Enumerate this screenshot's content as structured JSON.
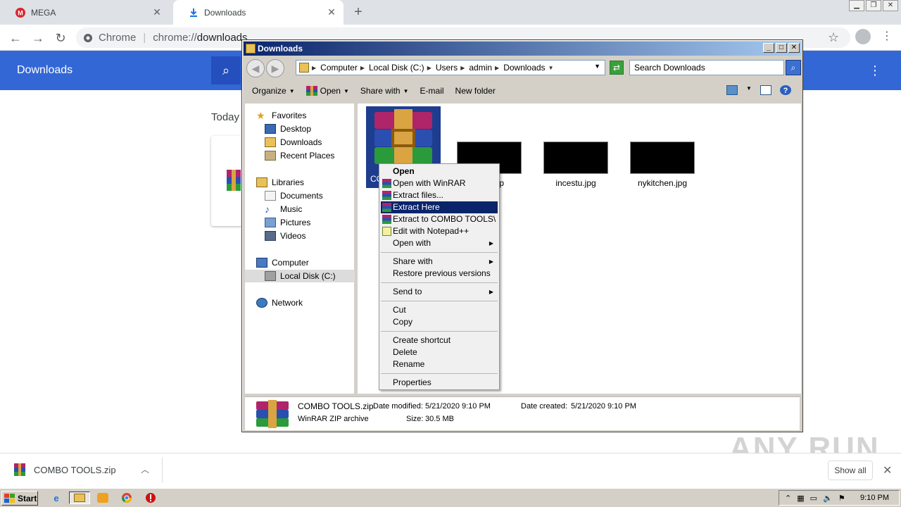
{
  "browser": {
    "tabs": [
      {
        "label": "MEGA",
        "favicon": "mega-icon"
      },
      {
        "label": "Downloads",
        "favicon": "download-icon"
      }
    ],
    "omnibox": {
      "site": "Chrome",
      "url_prefix": "chrome://",
      "url_path": "downloads"
    }
  },
  "downloads_page": {
    "title": "Downloads",
    "section": "Today"
  },
  "explorer": {
    "title": "Downloads",
    "breadcrumb": [
      "Computer",
      "Local Disk (C:)",
      "Users",
      "admin",
      "Downloads"
    ],
    "search_placeholder": "Search Downloads",
    "commands": {
      "organize": "Organize",
      "open": "Open",
      "share": "Share with",
      "email": "E-mail",
      "new_folder": "New folder"
    },
    "nav": {
      "favorites": "Favorites",
      "desktop": "Desktop",
      "downloads": "Downloads",
      "recent": "Recent Places",
      "libraries": "Libraries",
      "documents": "Documents",
      "music": "Music",
      "pictures": "Pictures",
      "videos": "Videos",
      "computer": "Computer",
      "local_disk": "Local Disk (C:)",
      "network": "Network"
    },
    "files": {
      "selected_partial": "CO",
      "f1": "nce.jp",
      "f2": "incestu.jpg",
      "f3": "nykitchen.jpg"
    },
    "details": {
      "name": "COMBO TOOLS.zip",
      "modified_label": "Date modified:",
      "modified": "5/21/2020 9:10 PM",
      "created_label": "Date created:",
      "created": "5/21/2020 9:10 PM",
      "type": "WinRAR ZIP archive",
      "size_label": "Size:",
      "size": "30.5 MB"
    }
  },
  "context_menu": {
    "open": "Open",
    "open_winrar": "Open with WinRAR",
    "extract_files": "Extract files...",
    "extract_here": "Extract Here",
    "extract_to": "Extract to COMBO TOOLS\\",
    "edit_notepad": "Edit with Notepad++",
    "open_with": "Open with",
    "share_with": "Share with",
    "restore": "Restore previous versions",
    "send_to": "Send to",
    "cut": "Cut",
    "copy": "Copy",
    "create_shortcut": "Create shortcut",
    "delete": "Delete",
    "rename": "Rename",
    "properties": "Properties"
  },
  "shelf": {
    "file": "COMBO TOOLS.zip",
    "show_all": "Show all"
  },
  "watermark": "ANY RUN",
  "taskbar": {
    "start": "Start",
    "clock": "9:10 PM"
  }
}
